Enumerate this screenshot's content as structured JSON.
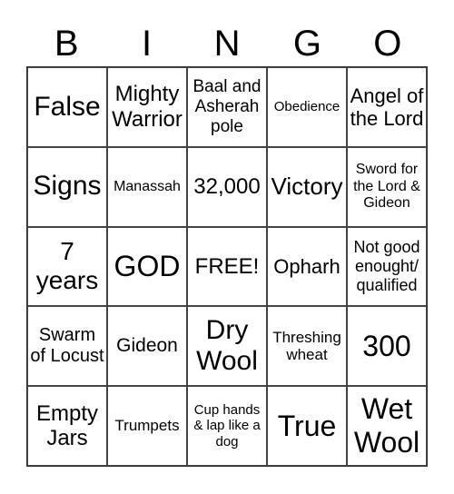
{
  "header": [
    "B",
    "I",
    "N",
    "G",
    "O"
  ],
  "cells": [
    "False",
    "Mighty Warrior",
    "Baal and Asherah pole",
    "Obedience",
    "Angel of the Lord",
    "Signs",
    "Manassah",
    "32,000",
    "Victory",
    "Sword for the Lord & Gideon",
    "7 years",
    "GOD",
    "FREE!",
    "Opharh",
    "Not good enought/ qualified",
    "Swarm of Locust",
    "Gideon",
    "Dry Wool",
    "Threshing wheat",
    "300",
    "Empty Jars",
    "Trumpets",
    "Cup hands & lap like a dog",
    "True",
    "Wet Wool"
  ]
}
